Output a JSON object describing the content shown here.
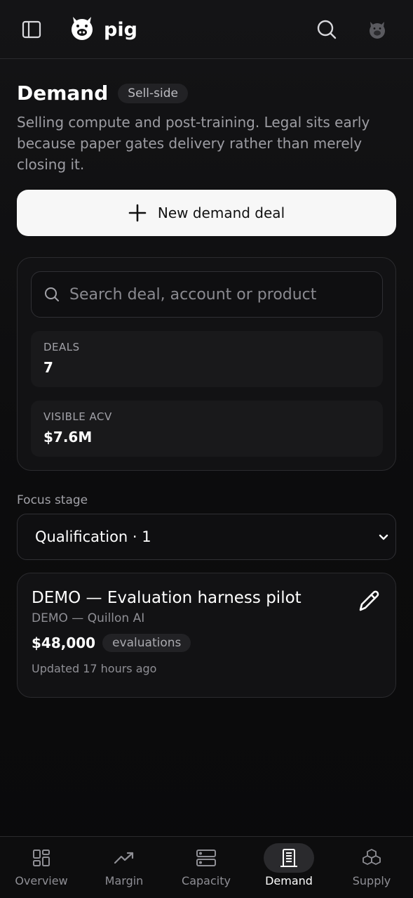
{
  "app": {
    "brand": "pig"
  },
  "icons": {
    "sidebar": "sidebar-toggle-icon",
    "logo": "pig-logo-icon",
    "search": "search-icon",
    "avatar": "pig-avatar-icon",
    "plus": "plus-icon",
    "edit": "pencil-icon",
    "chevron": "chevron-down-icon"
  },
  "header": {
    "title": "Demand",
    "badge": "Sell-side",
    "description": "Selling compute and post-training. Legal sits early because paper gates delivery rather than merely closing it."
  },
  "new_deal_button": {
    "label": "New demand deal"
  },
  "search": {
    "placeholder": "Search deal, account or product",
    "value": ""
  },
  "stats": [
    {
      "label": "DEALS",
      "value": "7"
    },
    {
      "label": "VISIBLE ACV",
      "value": "$7.6M"
    }
  ],
  "focus": {
    "label": "Focus stage",
    "selected": "Qualification · 1"
  },
  "deal": {
    "title": "DEMO — Evaluation harness pilot",
    "account": "DEMO — Quillon AI",
    "amount": "$48,000",
    "tag": "evaluations",
    "updated": "Updated 17 hours ago"
  },
  "nav": {
    "items": [
      {
        "label": "Overview",
        "active": false
      },
      {
        "label": "Margin",
        "active": false
      },
      {
        "label": "Capacity",
        "active": false
      },
      {
        "label": "Demand",
        "active": true
      },
      {
        "label": "Supply",
        "active": false
      }
    ]
  },
  "colors": {
    "background": "#0b0b0c",
    "surface": "#121214",
    "primary_button": "#f7f7f7",
    "muted_text": "#9d9da3"
  }
}
